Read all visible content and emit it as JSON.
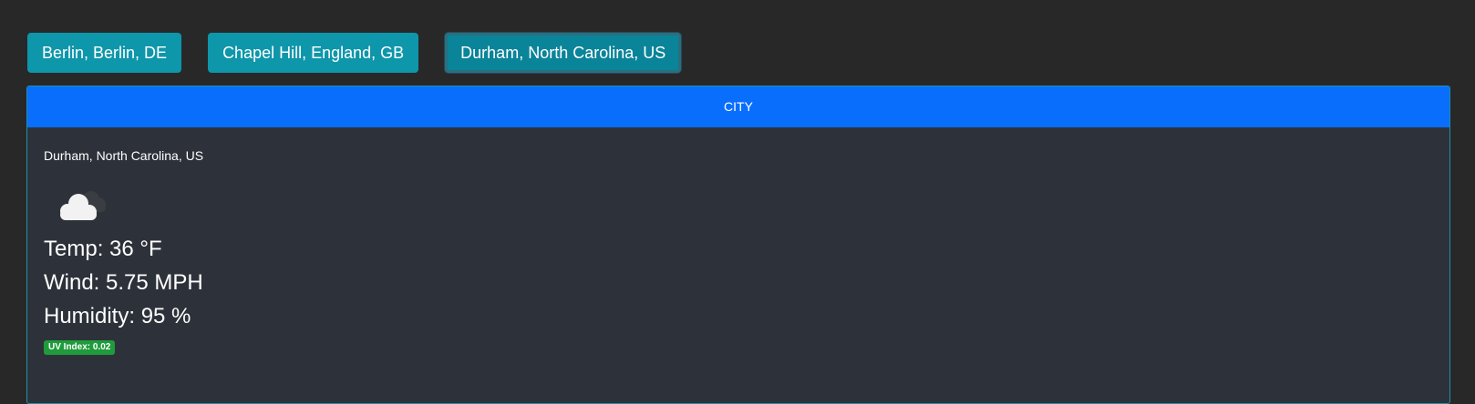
{
  "cities": [
    {
      "label": "Berlin, Berlin, DE"
    },
    {
      "label": "Chapel Hill, England, GB"
    },
    {
      "label": "Durham, North Carolina, US"
    }
  ],
  "card": {
    "header": "CITY",
    "location": "Durham, North Carolina, US",
    "icon": "cloud-icon",
    "temp": "Temp: 36 °F",
    "wind": "Wind: 5.75 MPH",
    "humidity": "Humidity: 95 %",
    "uv": "UV Index: 0.02"
  },
  "colors": {
    "background": "#282829",
    "button": "#0e96aa",
    "header": "#0a6efd",
    "card": "#2d323a",
    "uv_badge": "#1f9b3c"
  }
}
